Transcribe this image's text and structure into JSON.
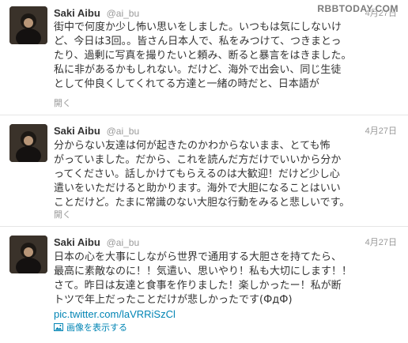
{
  "watermark": "RBBTODAY.COM",
  "tweets": [
    {
      "name": "Saki Aibu",
      "handle": "@ai_bu",
      "date": "4月27日",
      "lines": [
        "街中で何度か少し怖い思いをしました。いつもは気にしないけ",
        "ど、今日は3回。。皆さん日本人で、私をみつけて、つきまとっ",
        "たり、過剰に写真を撮りたいと頼み、断ると暴言をはきました。",
        "私に非があるかもしれない。だけど、海外で出会い、同じ生徒",
        "として仲良くしてくれてる方達と一緒の時だと、日本語が"
      ],
      "action": "開く"
    },
    {
      "name": "Saki Aibu",
      "handle": "@ai_bu",
      "date": "4月27日",
      "lines": [
        "分からない友達は何が起きたのかわからないまま、とても怖",
        "がっていました。だから、これを読んだ方だけでいいから分か",
        "ってください。話しかけてもらえるのは大歓迎！だけど少し心",
        "遣いをいただけると助かります。海外で大胆になることはいい",
        "ことだけど。たまに常識のない大胆な行動をみると悲しいです。"
      ],
      "action": "開く"
    },
    {
      "name": "Saki Aibu",
      "handle": "@ai_bu",
      "date": "4月27日",
      "lines": [
        "日本の心を大事にしながら世界で通用する大胆さを持てたら、",
        "最高に素敵なのに！！気遣い、思いやり！私も大切にします！！",
        "さて。昨日は友達と食事を作りました！楽しかったー！私が断",
        "トツで年上だったことだけが悲しかったです(ФдФ)"
      ],
      "link": "pic.twitter.com/laVRRiSzCl",
      "action": "画像を表示する"
    }
  ]
}
